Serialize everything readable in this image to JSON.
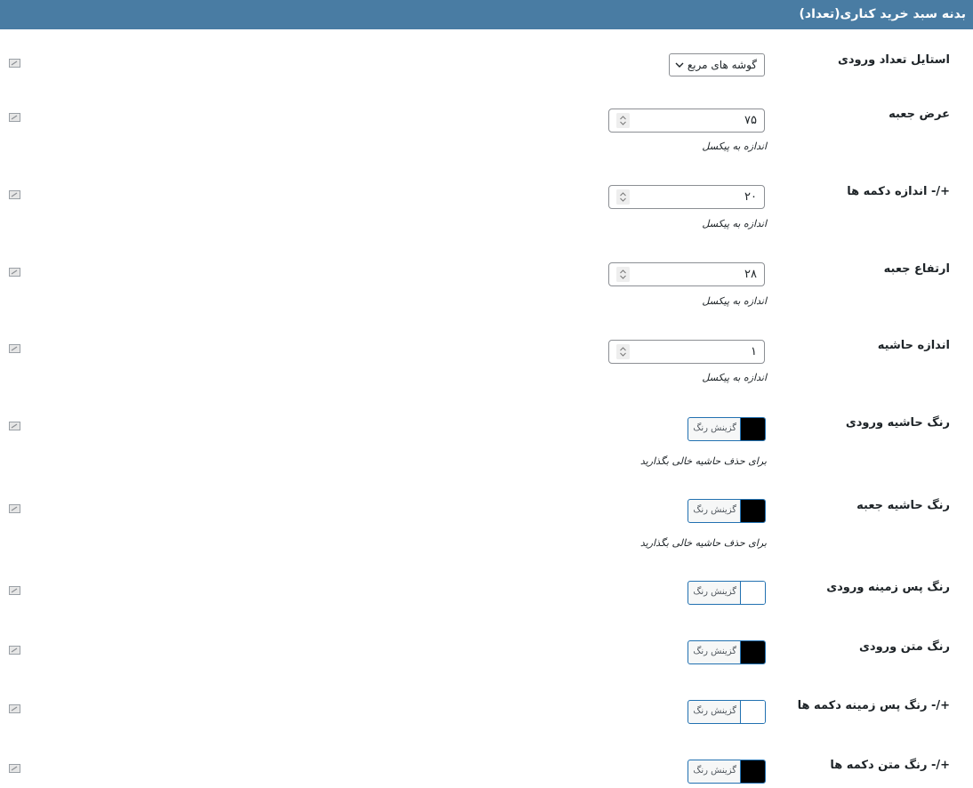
{
  "header": {
    "title": "بدنه سبد خرید کناری(تعداد)"
  },
  "colors": {
    "header_bg": "#497ca3",
    "border_accent": "#2271b1"
  },
  "rows": [
    {
      "label": "استایل تعداد ورودی",
      "type": "select",
      "value": "گوشه های مربع"
    },
    {
      "label": "عرض جعبه",
      "type": "number",
      "value": "۷۵",
      "hint": "اندازه به پیکسل"
    },
    {
      "label": "+/- اندازه دکمه ها",
      "type": "number",
      "value": "۲۰",
      "hint": "اندازه به پیکسل"
    },
    {
      "label": "ارتفاع جعبه",
      "type": "number",
      "value": "۲۸",
      "hint": "اندازه به پیکسل"
    },
    {
      "label": "اندازه حاشیه",
      "type": "number",
      "value": "۱",
      "hint": "اندازه به پیکسل"
    },
    {
      "label": "رنگ حاشیه ورودی",
      "type": "color",
      "button_text": "گزینش رنگ",
      "color": "#000000",
      "hint": "برای حذف حاشیه خالی بگذارید"
    },
    {
      "label": "رنگ حاشیه جعبه",
      "type": "color",
      "button_text": "گزینش رنگ",
      "color": "#000000",
      "hint": "برای حذف حاشیه خالی بگذارید"
    },
    {
      "label": "رنگ پس زمینه ورودی",
      "type": "color",
      "button_text": "گزینش رنگ",
      "color": "#ffffff"
    },
    {
      "label": "رنگ متن ورودی",
      "type": "color",
      "button_text": "گزینش رنگ",
      "color": "#000000"
    },
    {
      "label": "+/- رنگ پس زمینه دکمه ها",
      "type": "color",
      "button_text": "گزینش رنگ",
      "color": "#ffffff"
    },
    {
      "label": "+/- رنگ متن دکمه ها",
      "type": "color",
      "button_text": "گزینش رنگ",
      "color": "#000000"
    }
  ]
}
